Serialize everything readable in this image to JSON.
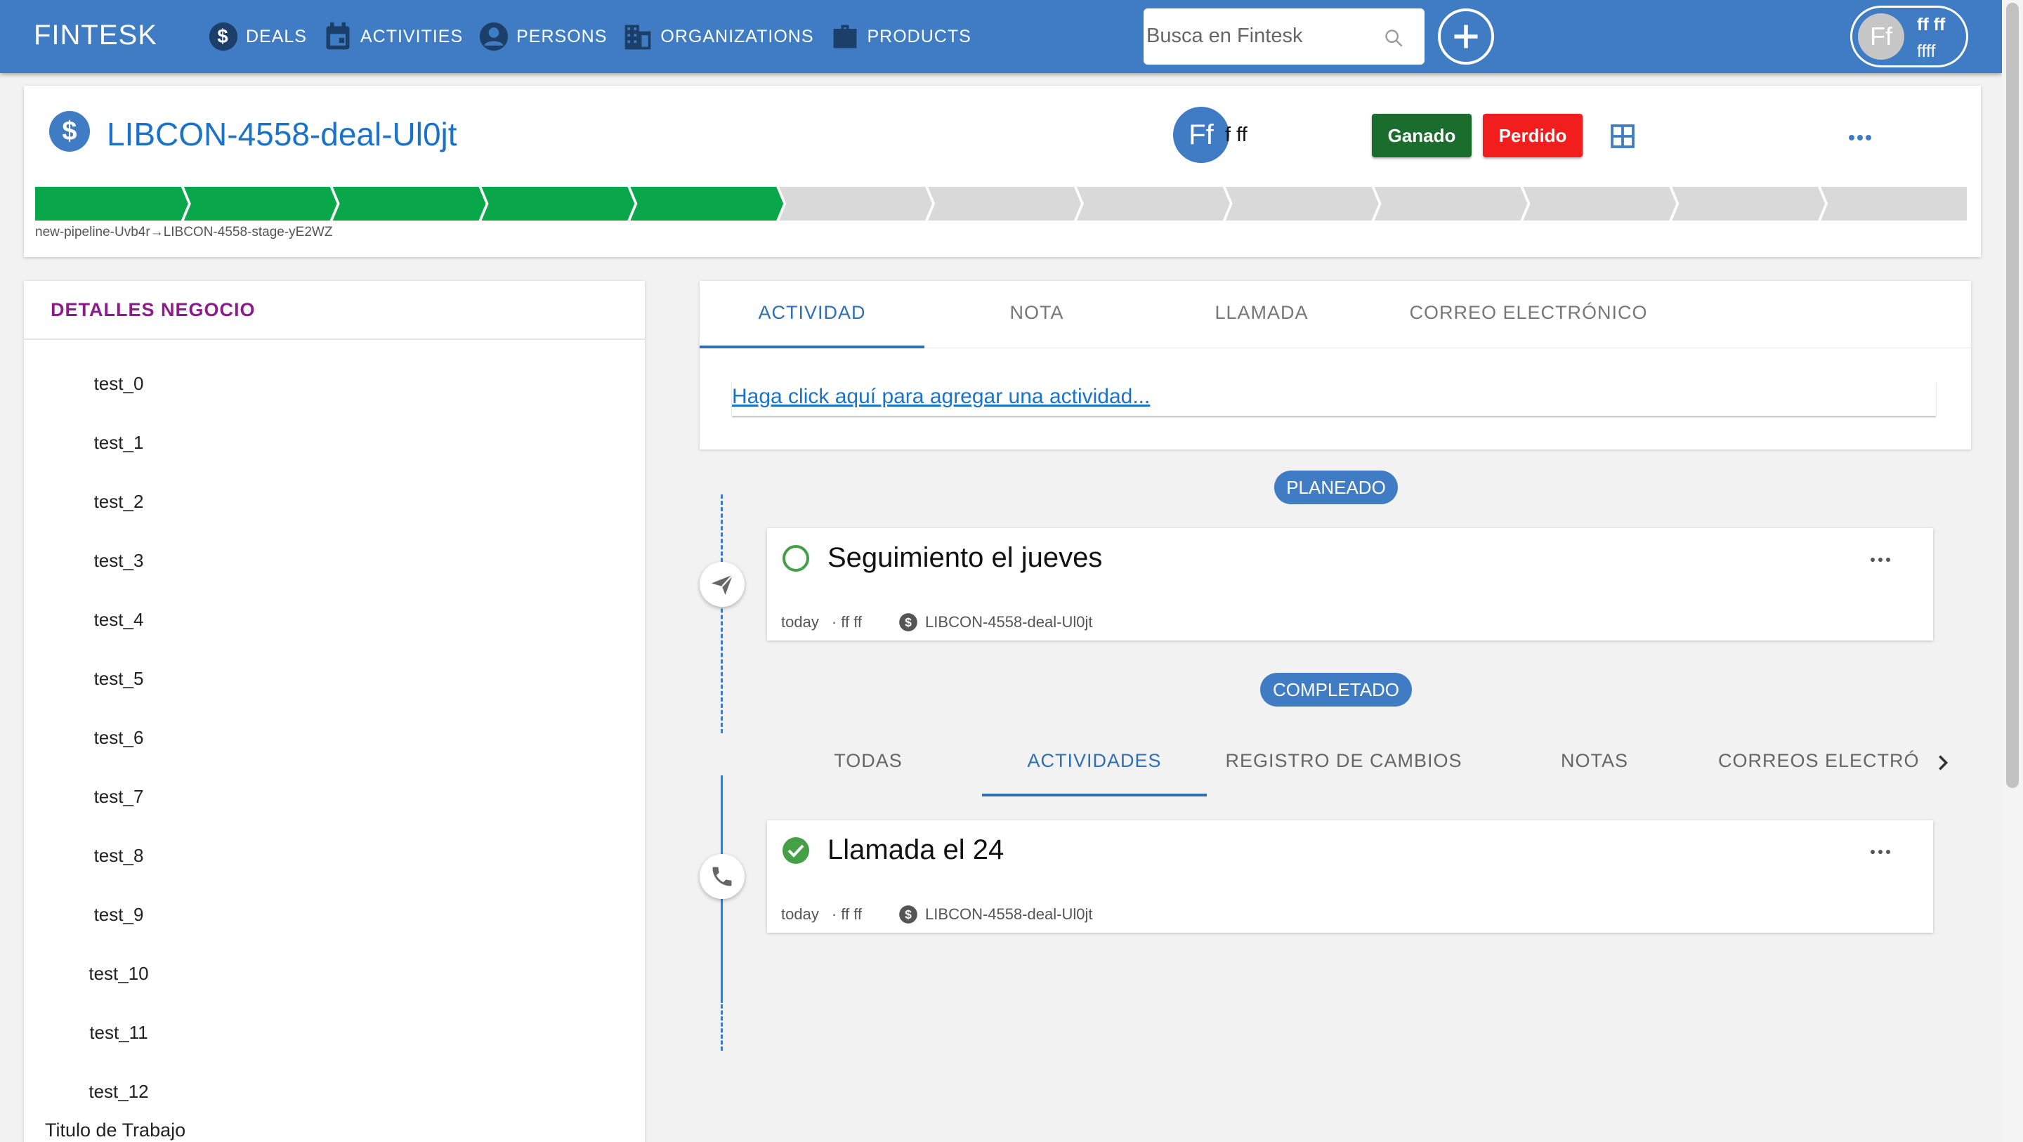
{
  "app": {
    "brand": "FINTESK",
    "colors": {
      "primary": "#3f7cc4",
      "won": "#1a6d2c",
      "lost": "#f21d1d",
      "done": "#43a047",
      "stage_done": "#0aa64a",
      "stage_todo": "#d9d9d9"
    }
  },
  "nav": {
    "items": [
      {
        "label": "DEALS",
        "icon": "dollar-icon"
      },
      {
        "label": "ACTIVITIES",
        "icon": "calendar-icon"
      },
      {
        "label": "PERSONS",
        "icon": "person-icon"
      },
      {
        "label": "ORGANIZATIONS",
        "icon": "building-icon"
      },
      {
        "label": "PRODUCTS",
        "icon": "briefcase-icon"
      }
    ]
  },
  "search": {
    "placeholder": "Busca en Fintesk",
    "value": ""
  },
  "user": {
    "initials": "Ff",
    "name": "ff ff",
    "subtitle": "ffff"
  },
  "deal": {
    "title": "LIBCON-4558-deal-Ul0jt",
    "owner_initials": "Ff",
    "owner_name": "f ff",
    "won_label": "Ganado",
    "lost_label": "Perdido",
    "pipeline": {
      "stage_count": 13,
      "completed_stages": 5
    },
    "breadcrumb": "new-pipeline-Uvb4r→LIBCON-4558-stage-yE2WZ"
  },
  "details": {
    "title": "DETALLES NEGOCIO",
    "fields": [
      "test_0",
      "test_1",
      "test_2",
      "test_3",
      "test_4",
      "test_5",
      "test_6",
      "test_7",
      "test_8",
      "test_9",
      "test_10",
      "test_11",
      "test_12"
    ],
    "job_title_label": "Titulo de Trabajo"
  },
  "composer": {
    "tabs": [
      "ACTIVIDAD",
      "NOTA",
      "LLAMADA",
      "CORREO ELECTRÓNICO"
    ],
    "active_tab": 0,
    "add_link": "Haga click aquí para agregar una actividad..."
  },
  "timeline": {
    "planned_label": "PLANEADO",
    "completed_label": "COMPLETADO",
    "planned": {
      "title": "Seguimiento el jueves",
      "when": "today",
      "who": "· ff ff",
      "deal": "LIBCON-4558-deal-Ul0jt",
      "type_icon": "send-icon"
    },
    "completed": {
      "title": "Llamada el 24",
      "when": "today",
      "who": "· ff ff",
      "deal": "LIBCON-4558-deal-Ul0jt",
      "type_icon": "phone-icon"
    }
  },
  "history": {
    "tabs": [
      "TODAS",
      "ACTIVIDADES",
      "REGISTRO DE CAMBIOS",
      "NOTAS",
      "CORREOS ELECTRÓ"
    ],
    "active_tab": 1
  }
}
